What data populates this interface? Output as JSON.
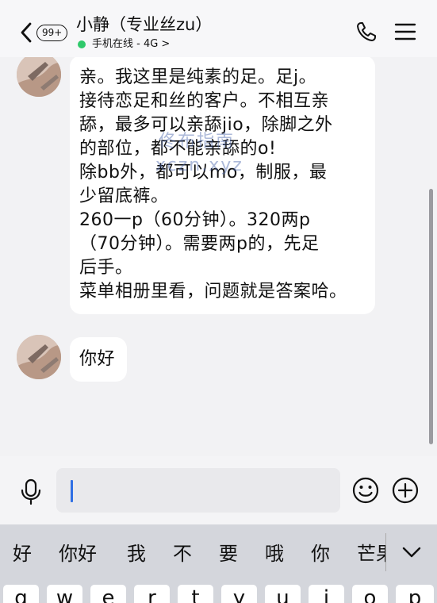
{
  "header": {
    "unread_badge": "99+",
    "title": "小静（专业丝zu）",
    "status": "手机在线 - 4G",
    "status_chevron": ">",
    "icons": [
      "back-chevron-icon",
      "phone-icon",
      "menu-icon"
    ]
  },
  "messages": [
    {
      "lines": [
        "亲。我这里是纯素的足。足j。",
        "接待恋足和丝的客户。不相互亲",
        "舔，最多可以亲舔jio，除脚之外",
        "的部位，都不能亲舔的o!",
        "除bb外，都可以mo，制服，最",
        "少留底裤。",
        "260一p（60分钟）。320两p",
        "（70分钟）。需要两p的，先足",
        "后手。",
        "菜单相册里看，问题就是答案哈。"
      ]
    },
    {
      "lines": [
        "你好"
      ]
    }
  ],
  "watermark": {
    "line1": "佟布指南",
    "line2": "xczn.xyz"
  },
  "input": {
    "value": "",
    "icons": [
      "microphone-icon",
      "emoji-icon",
      "plus-icon"
    ]
  },
  "keyboard": {
    "suggestions": [
      "好",
      "你好",
      "我",
      "不",
      "要",
      "哦",
      "你",
      "芒果"
    ],
    "keys": [
      "q",
      "w",
      "e",
      "r",
      "t",
      "y",
      "u",
      "i",
      "o",
      "p"
    ]
  },
  "colors": {
    "online_dot": "#2fc96b",
    "caret": "#2f6fe4",
    "bubble": "#ffffff",
    "background": "#f2f2f4"
  }
}
